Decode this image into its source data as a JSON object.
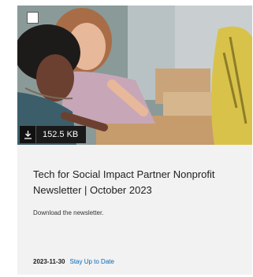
{
  "card": {
    "file_size": "152.5 KB",
    "title": "Tech for Social Impact Partner Nonprofit Newsletter | October 2023",
    "description": "Download the newsletter.",
    "date": "2023-11-30",
    "tag": "Stay Up to Date"
  },
  "icons": {
    "download": "download-icon",
    "checkbox": "checkbox-icon"
  },
  "colors": {
    "card_bg": "#f2f2f2",
    "link": "#0067b8",
    "badge_bg": "#1a1a1a"
  }
}
